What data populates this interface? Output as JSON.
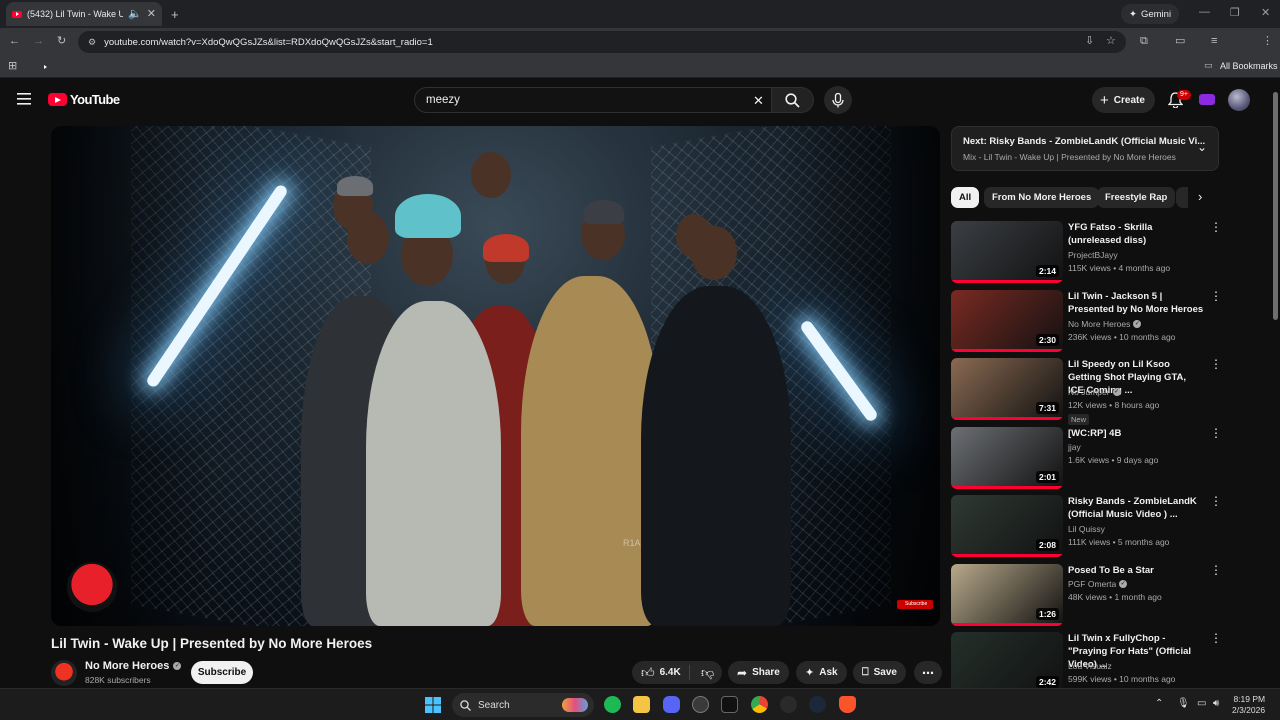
{
  "browser": {
    "tab_title": "(5432) Lil Twin - Wake Up |",
    "gemini_label": "Gemini",
    "url": "youtube.com/watch?v=XdoQwQGsJZs&list=RDXdoQwQGsJZs&start_radio=1",
    "all_bookmarks": "All Bookmarks"
  },
  "header": {
    "logo_text": "YouTube",
    "search_value": "meezy",
    "create_label": "Create",
    "notif_count": "9+"
  },
  "video": {
    "watermark_text": "R1A",
    "subscribe_overlay": "Subscribe",
    "title": "Lil Twin - Wake Up | Presented by No More Heroes",
    "channel": "No More Heroes",
    "subscribers": "828K subscribers",
    "subscribe_label": "Subscribe",
    "likes": "6.4K",
    "share_label": "Share",
    "ask_label": "Ask",
    "save_label": "Save"
  },
  "up_next": {
    "title_prefix": "Next:",
    "title": "Risky Bands - ZombieLandK (Official Music Vi...",
    "subtitle": "Mix - Lil Twin - Wake Up | Presented by No More Heroes"
  },
  "chips": [
    "All",
    "From No More Heroes",
    "Freestyle Rap"
  ],
  "recommendations": [
    {
      "title": "YFG Fatso - Skrilla (unreleased diss)",
      "channel": "ProjectBJayy",
      "verified": false,
      "meta": "115K views • 4 months ago",
      "duration": "2:14",
      "new": false,
      "thumb_color": "#3b3f44"
    },
    {
      "title": "Lil Twin - Jackson 5 | Presented by No More Heroes",
      "channel": "No More Heroes",
      "verified": true,
      "meta": "236K views • 10 months ago",
      "duration": "2:30",
      "new": false,
      "thumb_color": "#7a2a22"
    },
    {
      "title": "Lil Speedy on Lil Ksoo Getting Shot Playing GTA, ICE Coming ...",
      "channel": "No Jumper",
      "verified": true,
      "meta": "12K views • 8 hours ago",
      "duration": "7:31",
      "new": true,
      "new_label": "New",
      "thumb_color": "#8a6a52"
    },
    {
      "title": "[WC:RP] 4B",
      "channel": "jjay",
      "verified": false,
      "meta": "1.6K views • 9 days ago",
      "duration": "2:01",
      "new": false,
      "thumb_color": "#6c6f74"
    },
    {
      "title": "Risky Bands - ZombieLandK (Official Music Video ) ...",
      "channel": "Lil Quissy",
      "verified": false,
      "meta": "111K views • 5 months ago",
      "duration": "2:08",
      "new": false,
      "thumb_color": "#2f3a34"
    },
    {
      "title": "Posed To Be a Star",
      "channel": "PGF Omerta",
      "verified": true,
      "meta": "48K views • 1 month ago",
      "duration": "1:26",
      "new": false,
      "thumb_color": "#b8a98a"
    },
    {
      "title": "Lil Twin x FullyChop - \"Praying For Hats\" (Official Video) ...",
      "channel": "Lou Visualz",
      "verified": false,
      "meta": "599K views • 10 months ago",
      "duration": "2:42",
      "new": false,
      "thumb_color": "#24302a"
    }
  ],
  "taskbar": {
    "search_label": "Search",
    "time": "8:19 PM",
    "date": "2/3/2026"
  }
}
